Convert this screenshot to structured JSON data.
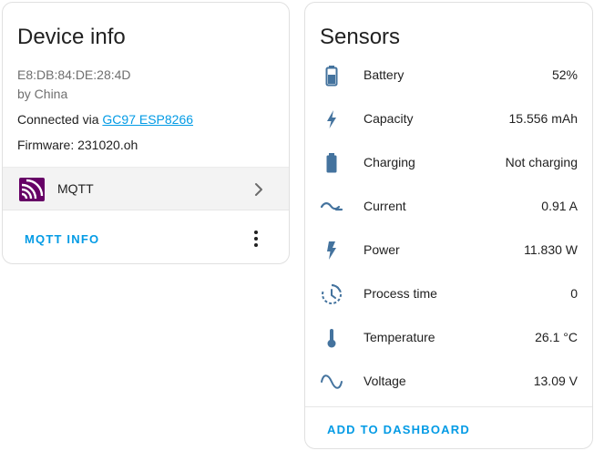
{
  "device_info": {
    "title": "Device info",
    "mac": "E8:DB:84:DE:28:4D",
    "manufacturer": "by China",
    "connected_prefix": "Connected via ",
    "connected_link": "GC97 ESP8266",
    "firmware": "Firmware: 231020.oh",
    "integration": {
      "label": "MQTT",
      "icon": "mqtt-logo-icon",
      "color": "#660066"
    },
    "action_label": "MQTT INFO"
  },
  "sensors": {
    "title": "Sensors",
    "icon_color": "#44739e",
    "items": [
      {
        "label": "Battery",
        "value": "52%",
        "icon": "battery-icon"
      },
      {
        "label": "Capacity",
        "value": "15.556 mAh",
        "icon": "lightning-bolt-icon"
      },
      {
        "label": "Charging",
        "value": "Not charging",
        "icon": "battery-icon"
      },
      {
        "label": "Current",
        "value": "0.91 A",
        "icon": "current-ac-icon"
      },
      {
        "label": "Power",
        "value": "11.830 W",
        "icon": "flash-icon"
      },
      {
        "label": "Process time",
        "value": "0",
        "icon": "timer-icon"
      },
      {
        "label": "Temperature",
        "value": "26.1 °C",
        "icon": "thermometer-icon"
      },
      {
        "label": "Voltage",
        "value": "13.09 V",
        "icon": "sine-wave-icon"
      }
    ],
    "action_label": "ADD TO DASHBOARD"
  },
  "colors": {
    "accent": "#039be5",
    "icon": "#44739e"
  }
}
